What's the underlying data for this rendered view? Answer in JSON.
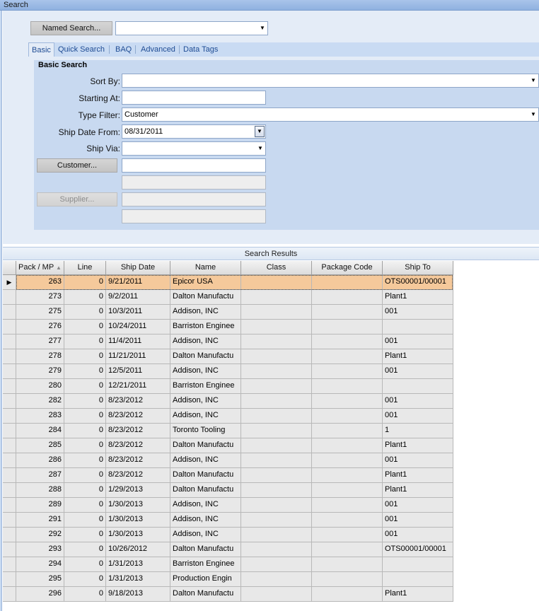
{
  "window": {
    "title": "Search"
  },
  "named_search": {
    "button_label": "Named Search...",
    "value": ""
  },
  "tabs": [
    {
      "label": "Basic",
      "active": true
    },
    {
      "label": "Quick Search",
      "active": false
    },
    {
      "label": "BAQ",
      "active": false
    },
    {
      "label": "Advanced",
      "active": false
    },
    {
      "label": "Data Tags",
      "active": false
    }
  ],
  "basic_search": {
    "title": "Basic Search",
    "sort_by": {
      "label": "Sort By:",
      "value": ""
    },
    "starting_at": {
      "label": "Starting At:",
      "value": ""
    },
    "type_filter": {
      "label": "Type Filter:",
      "value": "Customer"
    },
    "ship_date_from": {
      "label": "Ship Date From:",
      "value": "08/31/2011"
    },
    "ship_via": {
      "label": "Ship Via:",
      "value": ""
    },
    "customer": {
      "button_label": "Customer...",
      "value": "",
      "secondary_value": ""
    },
    "supplier": {
      "button_label": "Supplier...",
      "value": "",
      "secondary_value": ""
    }
  },
  "results": {
    "title": "Search Results",
    "columns": [
      "Pack / MP",
      "Line",
      "Ship Date",
      "Name",
      "Class",
      "Package Code",
      "Ship To"
    ],
    "sort_indicator": "▲",
    "selected_row": 0,
    "rows": [
      [
        "263",
        "0",
        "9/21/2011",
        "Epicor USA",
        "",
        "",
        "OTS00001/00001"
      ],
      [
        "273",
        "0",
        "9/2/2011",
        "Dalton Manufactu",
        "",
        "",
        "Plant1"
      ],
      [
        "275",
        "0",
        "10/3/2011",
        "Addison, INC",
        "",
        "",
        "001"
      ],
      [
        "276",
        "0",
        "10/24/2011",
        "Barriston Enginee",
        "",
        "",
        ""
      ],
      [
        "277",
        "0",
        "11/4/2011",
        "Addison, INC",
        "",
        "",
        "001"
      ],
      [
        "278",
        "0",
        "11/21/2011",
        "Dalton Manufactu",
        "",
        "",
        "Plant1"
      ],
      [
        "279",
        "0",
        "12/5/2011",
        "Addison, INC",
        "",
        "",
        "001"
      ],
      [
        "280",
        "0",
        "12/21/2011",
        "Barriston Enginee",
        "",
        "",
        ""
      ],
      [
        "282",
        "0",
        "8/23/2012",
        "Addison, INC",
        "",
        "",
        "001"
      ],
      [
        "283",
        "0",
        "8/23/2012",
        "Addison, INC",
        "",
        "",
        "001"
      ],
      [
        "284",
        "0",
        "8/23/2012",
        "Toronto Tooling",
        "",
        "",
        "1"
      ],
      [
        "285",
        "0",
        "8/23/2012",
        "Dalton Manufactu",
        "",
        "",
        "Plant1"
      ],
      [
        "286",
        "0",
        "8/23/2012",
        "Addison, INC",
        "",
        "",
        "001"
      ],
      [
        "287",
        "0",
        "8/23/2012",
        "Dalton Manufactu",
        "",
        "",
        "Plant1"
      ],
      [
        "288",
        "0",
        "1/29/2013",
        "Dalton Manufactu",
        "",
        "",
        "Plant1"
      ],
      [
        "289",
        "0",
        "1/30/2013",
        "Addison, INC",
        "",
        "",
        "001"
      ],
      [
        "291",
        "0",
        "1/30/2013",
        "Addison, INC",
        "",
        "",
        "001"
      ],
      [
        "292",
        "0",
        "1/30/2013",
        "Addison, INC",
        "",
        "",
        "001"
      ],
      [
        "293",
        "0",
        "10/26/2012",
        "Dalton Manufactu",
        "",
        "",
        "OTS00001/00001"
      ],
      [
        "294",
        "0",
        "1/31/2013",
        "Barriston Enginee",
        "",
        "",
        ""
      ],
      [
        "295",
        "0",
        "1/31/2013",
        "Production Engin",
        "",
        "",
        ""
      ],
      [
        "296",
        "0",
        "9/18/2013",
        "Dalton Manufactu",
        "",
        "",
        "Plant1"
      ]
    ]
  }
}
